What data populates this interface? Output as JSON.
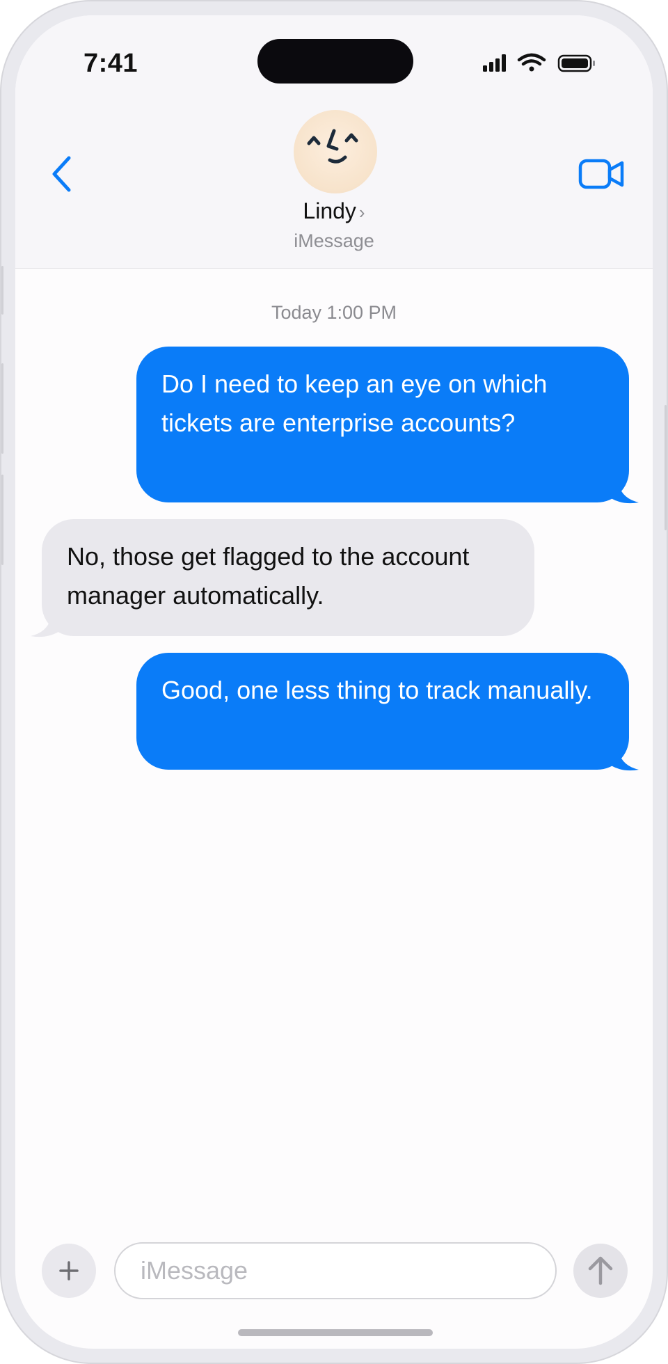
{
  "status_bar": {
    "time": "7:41"
  },
  "header": {
    "contact_name": "Lindy",
    "contact_chevron": "›",
    "service": "iMessage",
    "back_icon": "chevron-left-icon",
    "video_icon": "video-camera-icon",
    "accent_color": "#0a7cf8"
  },
  "conversation": {
    "timestamp": "Today 1:00 PM",
    "messages": [
      {
        "direction": "sent",
        "text": "Do I need to keep an eye on which tickets are enterprise accounts?"
      },
      {
        "direction": "received",
        "text": "No, those get flagged to the account manager automatically."
      },
      {
        "direction": "sent",
        "text": "Good, one less thing to track manually."
      }
    ],
    "sent_bubble_color": "#0a7cf8",
    "received_bubble_color": "#e9e8ed"
  },
  "composer": {
    "placeholder": "iMessage",
    "value": "",
    "plus_icon": "plus-icon",
    "send_icon": "arrow-up-icon"
  }
}
